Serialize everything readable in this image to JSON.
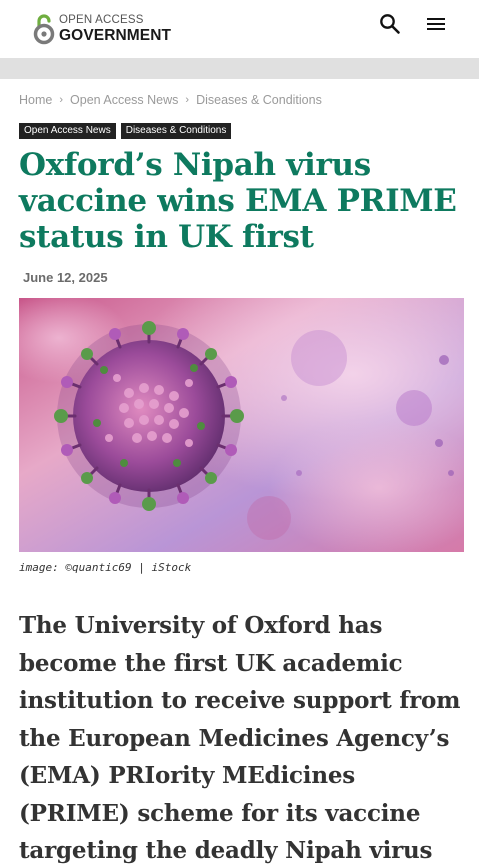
{
  "header": {
    "logo_top": "OPEN ACCESS",
    "logo_bottom": "GOVERNMENT",
    "search_icon": "search-icon",
    "menu_icon": "hamburger-menu-icon"
  },
  "breadcrumb": {
    "items": [
      "Home",
      "Open Access News",
      "Diseases & Conditions"
    ],
    "separator": "›"
  },
  "tags": [
    "Open Access News",
    "Diseases & Conditions"
  ],
  "article": {
    "title": "Oxford’s Nipah virus vaccine wins EMA PRIME status in UK first",
    "date": "June 12, 2025",
    "image_caption": "image: ©quantic69 | iStock",
    "lead": "The University of Oxford has become the first UK academic institution to receive support from the European Medicines Agency’s (EMA) PRIority MEdicines (PRIME) scheme for its vaccine targeting the deadly Nipah virus"
  },
  "colors": {
    "title": "#0e7a5f",
    "tag_bg": "#222222",
    "grey_bar": "#e0e0e0",
    "logo_accent": "#5a9e3a"
  }
}
